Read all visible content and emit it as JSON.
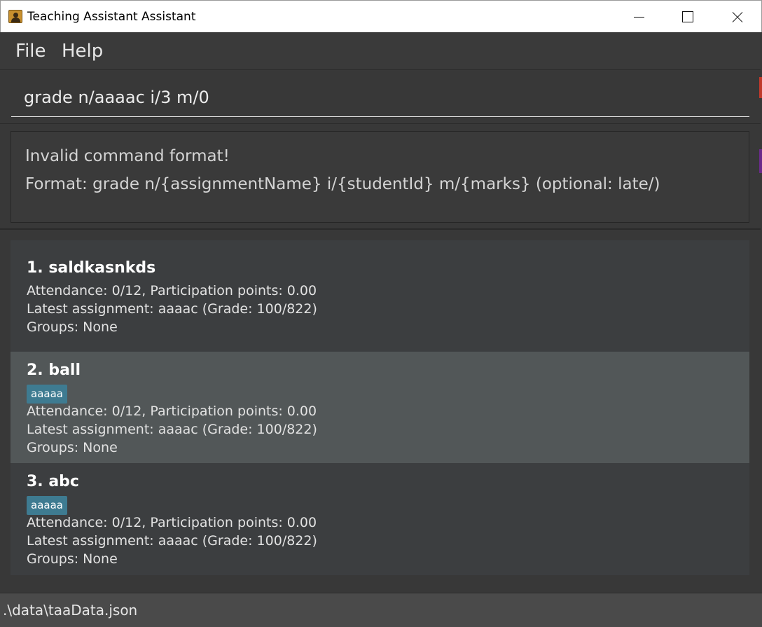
{
  "window": {
    "title": "Teaching Assistant Assistant"
  },
  "menu": {
    "file": "File",
    "help": "Help"
  },
  "command": {
    "value": "grade n/aaaac i/3 m/0"
  },
  "result": {
    "line1": "Invalid command format!",
    "line2": "Format: grade n/{assignmentName} i/{studentId} m/{marks} (optional: late/)"
  },
  "students": [
    {
      "title": "1.  saldkasnkds",
      "tag": "",
      "attendance": "Attendance: 0/12, Participation points: 0.00",
      "assignment": "Latest assignment: aaaac (Grade: 100/822)",
      "groups": "Groups: None"
    },
    {
      "title": "2.  ball",
      "tag": "aaaaa",
      "attendance": "Attendance: 0/12, Participation points: 0.00",
      "assignment": "Latest assignment: aaaac (Grade: 100/822)",
      "groups": "Groups: None"
    },
    {
      "title": "3.  abc",
      "tag": "aaaaa",
      "attendance": "Attendance: 0/12, Participation points: 0.00",
      "assignment": "Latest assignment: aaaac (Grade: 100/822)",
      "groups": "Groups: None"
    }
  ],
  "status": {
    "path": ".\\data\\taaData.json"
  }
}
